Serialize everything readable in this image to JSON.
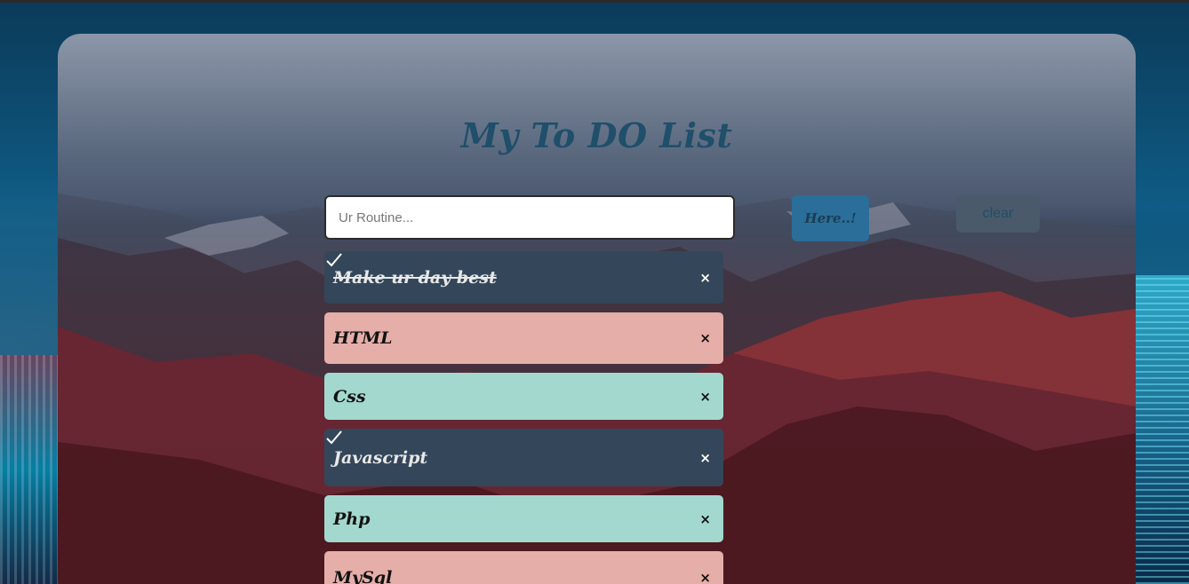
{
  "app": {
    "title": "My To DO List"
  },
  "form": {
    "placeholder": "Ur Routine...",
    "value": "",
    "add_label": "Here..!",
    "clear_label": "clear"
  },
  "todos": [
    {
      "text": "Make ur day best",
      "checked": true,
      "struck": true,
      "color": "#34465a"
    },
    {
      "text": "HTML",
      "checked": false,
      "struck": false,
      "color": "#e5aea9"
    },
    {
      "text": "Css",
      "checked": false,
      "struck": false,
      "color": "#a3d8cf"
    },
    {
      "text": "Javascript",
      "checked": true,
      "struck": false,
      "color": "#34465a"
    },
    {
      "text": "Php",
      "checked": false,
      "struck": false,
      "color": "#a3d8cf"
    },
    {
      "text": "MySql",
      "checked": false,
      "struck": false,
      "color": "#e5aea9"
    }
  ],
  "icons": {
    "close": "×",
    "check": "check-icon"
  },
  "colors": {
    "title": "#1f4f6a",
    "add_button": "#2b6e99",
    "clear_button": "#4a5a6b",
    "done_item": "#34465a",
    "pink_item": "#e5aea9",
    "mint_item": "#a3d8cf"
  }
}
